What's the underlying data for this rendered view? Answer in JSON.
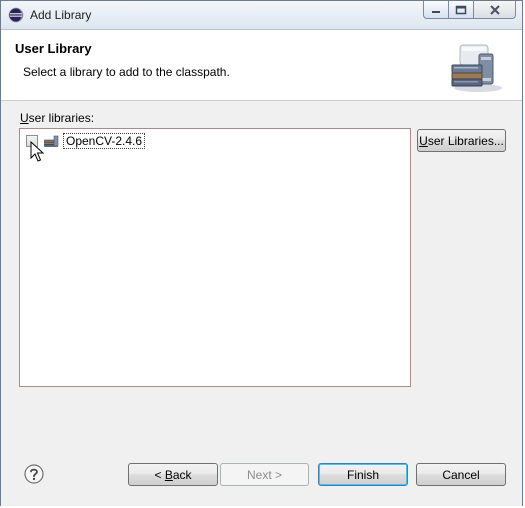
{
  "window": {
    "title": "Add Library",
    "icon": "eclipse-icon",
    "caption_buttons": [
      "minimize",
      "maximize",
      "close"
    ]
  },
  "header": {
    "title": "User Library",
    "description": "Select a library to add to the classpath.",
    "graphic": "library-books-icon"
  },
  "libraries": {
    "label_prefix": "U",
    "label_rest": "ser libraries:",
    "items": [
      {
        "label": "OpenCV-2.4.6",
        "checked": false,
        "icon": "library-icon"
      }
    ],
    "manage_button": {
      "prefix": "U",
      "rest": "ser Libraries..."
    }
  },
  "footer": {
    "help_icon": "help-icon",
    "back": {
      "prefix": "< ",
      "mnemonic": "B",
      "rest": "ack",
      "enabled": true
    },
    "next": {
      "label": "Next >",
      "enabled": false
    },
    "finish": {
      "label": "Finish",
      "enabled": true,
      "default": true
    },
    "cancel": {
      "label": "Cancel",
      "enabled": true
    }
  }
}
